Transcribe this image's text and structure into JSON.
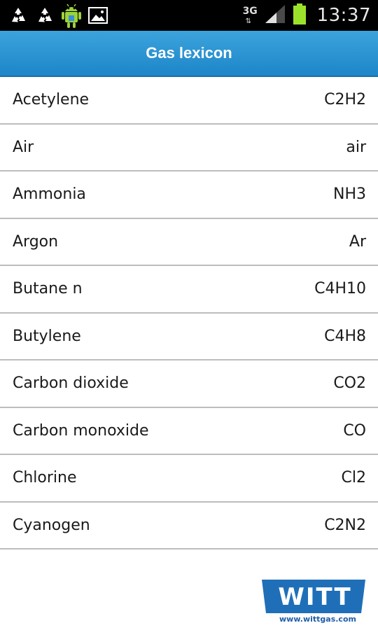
{
  "status_bar": {
    "icons": [
      "recycle-icon",
      "recycle-icon",
      "android-icon",
      "gallery-icon"
    ],
    "network_type": "3G",
    "time": "13:37"
  },
  "app": {
    "title": "Gas lexicon"
  },
  "gases": [
    {
      "name": "Acetylene",
      "formula": "C2H2"
    },
    {
      "name": "Air",
      "formula": "air"
    },
    {
      "name": "Ammonia",
      "formula": "NH3"
    },
    {
      "name": "Argon",
      "formula": "Ar"
    },
    {
      "name": "Butane n",
      "formula": "C4H10"
    },
    {
      "name": "Butylene",
      "formula": "C4H8"
    },
    {
      "name": "Carbon dioxide",
      "formula": "CO2"
    },
    {
      "name": "Carbon monoxide",
      "formula": "CO"
    },
    {
      "name": "Chlorine",
      "formula": "Cl2"
    },
    {
      "name": "Cyanogen",
      "formula": "C2N2"
    }
  ],
  "logo": {
    "brand": "WITT",
    "url": "www.wittgas.com",
    "color": "#1f6fb8"
  },
  "colors": {
    "accent": "#2a95d4",
    "battery": "#9be32a",
    "divider": "#bdbdbd"
  }
}
